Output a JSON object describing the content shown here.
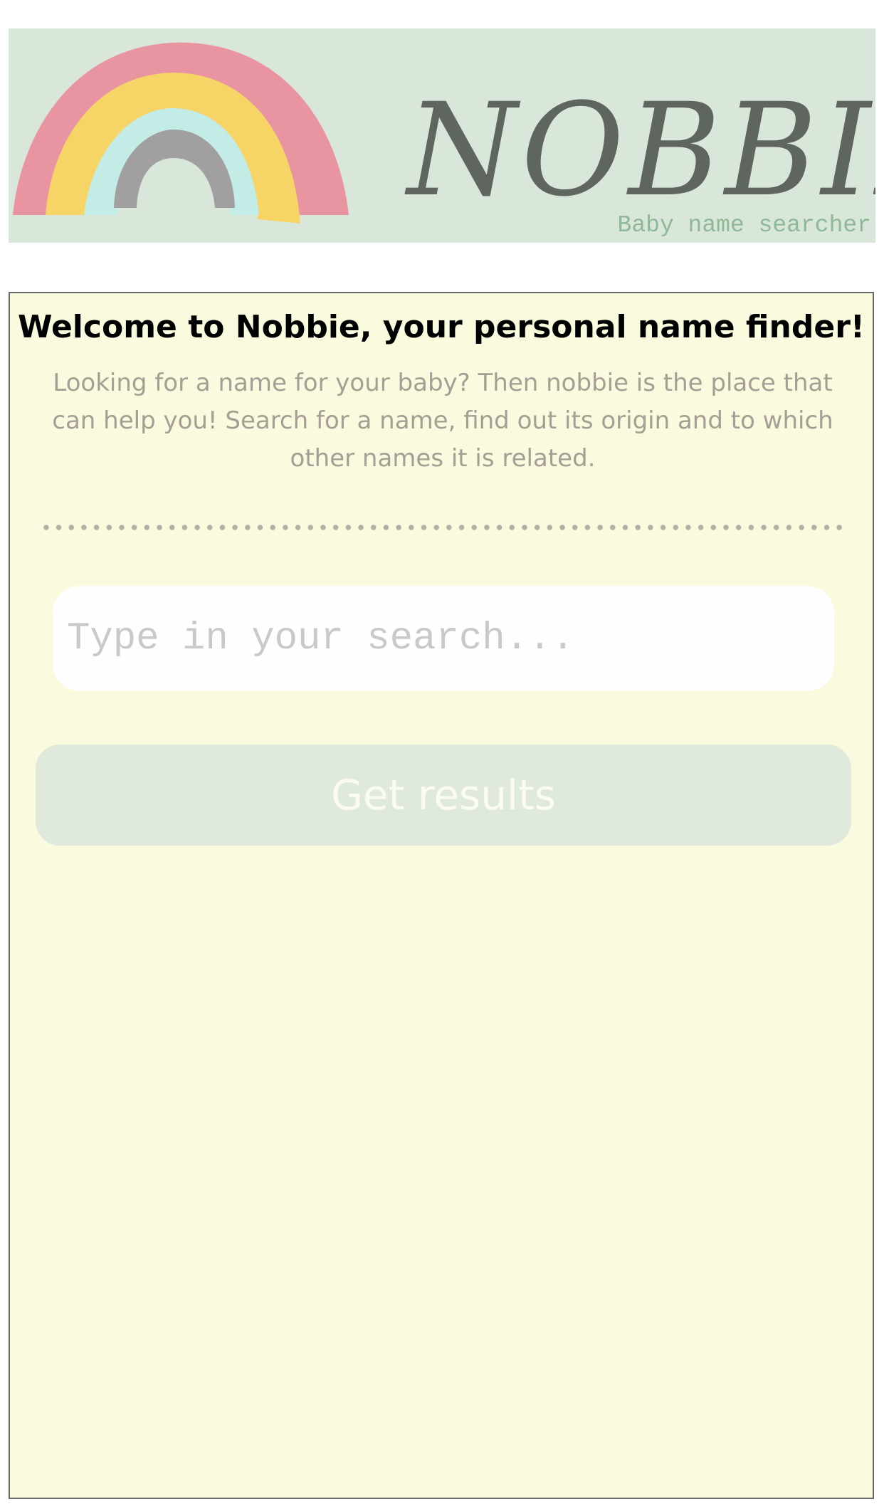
{
  "header": {
    "brand_name": "NOBBIE",
    "tagline": "Baby name searcher",
    "logo_icon": "rainbow-icon",
    "colors": {
      "banner_bg": "#d9e6da",
      "rainbow_outer": "#e895a1",
      "rainbow_middle": "#f6d466",
      "rainbow_inner": "#c2ece5",
      "rainbow_core": "#a19f9f",
      "brand_text": "#5f655f",
      "tagline_text": "#8fb896"
    }
  },
  "main": {
    "title": "Welcome to Nobbie, your personal name finder!",
    "intro": "Looking for a name for your baby? Then nobbie is the place that can help you! Search for a name, find out its origin and to which other names it is related.",
    "search": {
      "placeholder": "Type in your search...",
      "value": ""
    },
    "submit_label": "Get results",
    "colors": {
      "card_bg": "#fafadf",
      "button_bg": "#dfe9dc",
      "button_text": "#fbfbf4",
      "intro_text": "#a69d94"
    }
  }
}
